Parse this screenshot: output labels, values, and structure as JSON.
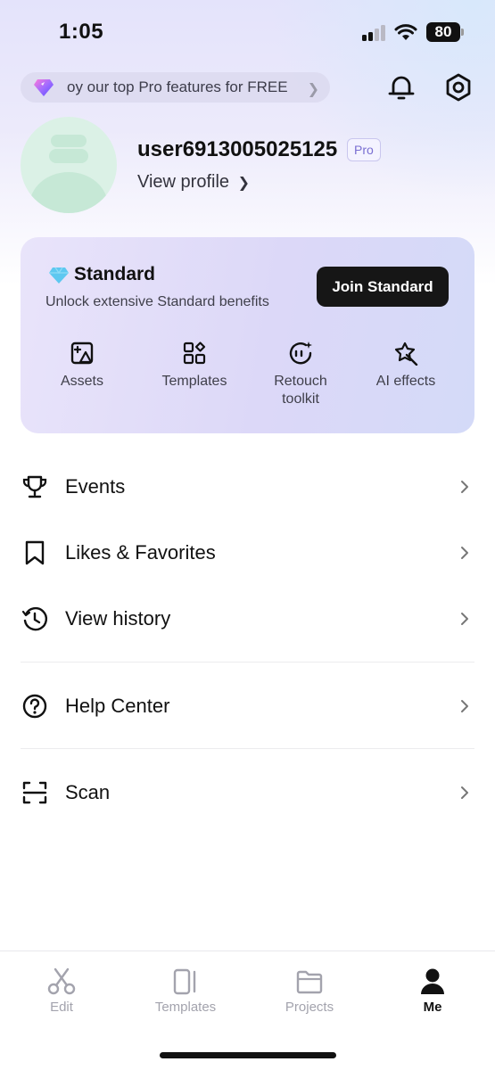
{
  "status_bar": {
    "time": "1:05",
    "battery": "80"
  },
  "promo": {
    "text": "oy our top Pro features for FREE",
    "icon": "diamond-icon"
  },
  "header_actions": {
    "notifications_icon": "bell-icon",
    "settings_icon": "gear-icon"
  },
  "profile": {
    "username": "user6913005025125",
    "badge": "Pro",
    "view_profile": "View profile"
  },
  "standard_card": {
    "title": "Standard",
    "subtitle": "Unlock extensive Standard benefits",
    "join_button": "Join Standard",
    "features": [
      {
        "label": "Assets",
        "icon": "image-shapes-icon"
      },
      {
        "label": "Templates",
        "icon": "grid-icon"
      },
      {
        "label": "Retouch\ntoolkit",
        "icon": "face-sparkle-icon"
      },
      {
        "label": "AI effects",
        "icon": "magic-star-icon"
      }
    ]
  },
  "menu": {
    "items": [
      {
        "label": "Events",
        "icon": "trophy-icon"
      },
      {
        "label": "Likes & Favorites",
        "icon": "bookmark-icon"
      },
      {
        "label": "View history",
        "icon": "history-icon"
      },
      {
        "label": "Help Center",
        "icon": "help-icon"
      },
      {
        "label": "Scan",
        "icon": "scan-icon"
      }
    ]
  },
  "bottom_nav": {
    "active": "Me",
    "items": [
      {
        "label": "Edit",
        "icon": "scissors-icon"
      },
      {
        "label": "Templates",
        "icon": "templates-icon"
      },
      {
        "label": "Projects",
        "icon": "folder-icon"
      },
      {
        "label": "Me",
        "icon": "person-icon"
      }
    ]
  },
  "colors": {
    "accent": "#7a6fd2",
    "card_background": "#dcd8f8",
    "join_button": "#161616",
    "avatar": "#dbf1e6"
  }
}
